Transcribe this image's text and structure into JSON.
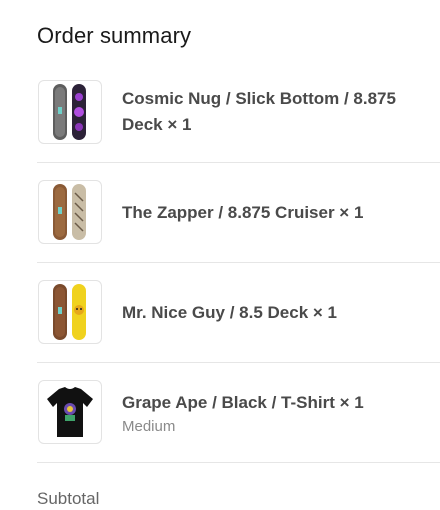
{
  "order_summary": {
    "title": "Order summary",
    "items": [
      {
        "name": "Cosmic Nug / Slick Bottom / 8.875 Deck × 1",
        "variant": "",
        "image_icon": "skateboard-deck-pair-icon",
        "deck_colors": [
          "#6d6d6d",
          "#3a2d4a"
        ]
      },
      {
        "name": "The Zapper / 8.875 Cruiser × 1",
        "variant": "",
        "image_icon": "skateboard-deck-pair-icon",
        "deck_colors": [
          "#8a5a36",
          "#cbbfa8"
        ]
      },
      {
        "name": "Mr. Nice Guy / 8.5 Deck × 1",
        "variant": "",
        "image_icon": "skateboard-deck-pair-icon",
        "deck_colors": [
          "#7a4a2c",
          "#f0d21e"
        ]
      },
      {
        "name": "Grape Ape / Black / T-Shirt × 1",
        "variant": "Medium",
        "image_icon": "tshirt-icon",
        "shirt_color": "#111111"
      }
    ],
    "subtotal_label": "Subtotal"
  }
}
